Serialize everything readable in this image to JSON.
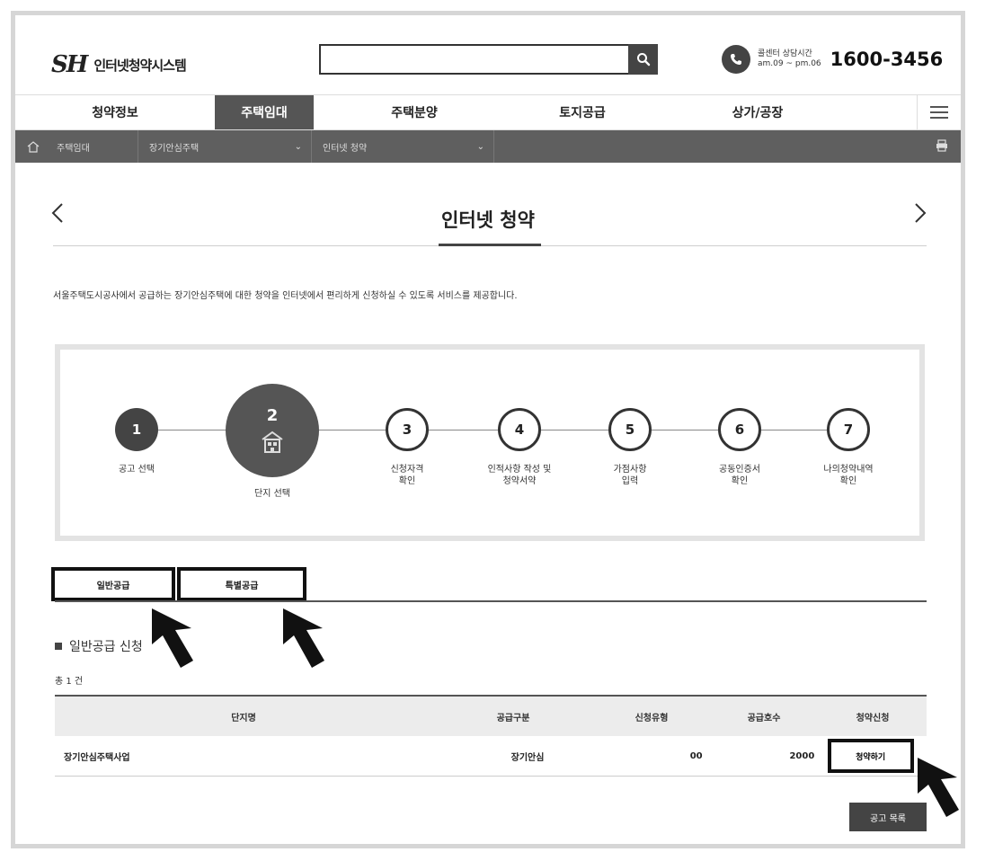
{
  "header": {
    "logo_mark": "SH",
    "logo_text": "인터넷청약시스템",
    "search_value": "",
    "call_label": "콜센터 상담시간",
    "call_hours": "am.09 ~ pm.06",
    "call_number": "1600-3456"
  },
  "gnb": {
    "items": [
      {
        "label": "청약정보"
      },
      {
        "label": "주택임대"
      },
      {
        "label": "주택분양"
      },
      {
        "label": "토지공급"
      },
      {
        "label": "상가/공장"
      }
    ],
    "active_index": 1
  },
  "lnb": {
    "home": "주택임대",
    "level2": "장기안심주택",
    "level3": "인터넷 청약"
  },
  "page": {
    "title": "인터넷 청약",
    "description": "서울주택도시공사에서 공급하는 장기안심주택에 대한 청약을 인터넷에서 편리하게 신청하실 수 있도록 서비스를 제공합니다."
  },
  "steps": [
    {
      "number": "1",
      "label": "공고 선택",
      "state": "done"
    },
    {
      "number": "2",
      "label": "단지 선택",
      "state": "current"
    },
    {
      "number": "3",
      "label": "신청자격\n확인",
      "state": "todo"
    },
    {
      "number": "4",
      "label": "인적사항 작성 및\n청약서약",
      "state": "todo"
    },
    {
      "number": "5",
      "label": "가점사항\n입력",
      "state": "todo"
    },
    {
      "number": "6",
      "label": "공동인증서\n확인",
      "state": "todo"
    },
    {
      "number": "7",
      "label": "나의청약내역\n확인",
      "state": "todo"
    }
  ],
  "tabs": [
    {
      "label": "일반공급"
    },
    {
      "label": "특별공급"
    }
  ],
  "section": {
    "heading": "일반공급 신청",
    "total": "총 1 건"
  },
  "table": {
    "headers": [
      "단지명",
      "공급구분",
      "신청유형",
      "공급호수",
      "청약신청"
    ],
    "rows": [
      {
        "name": "장기안심주택사업",
        "type": "장기안심",
        "apply_type": "00",
        "units": "2000",
        "action": "청약하기"
      }
    ]
  },
  "buttons": {
    "list": "공고 목록"
  },
  "colors": {
    "dark": "#444444",
    "lnb": "#5f5f5f",
    "border": "#e3e3e3"
  }
}
